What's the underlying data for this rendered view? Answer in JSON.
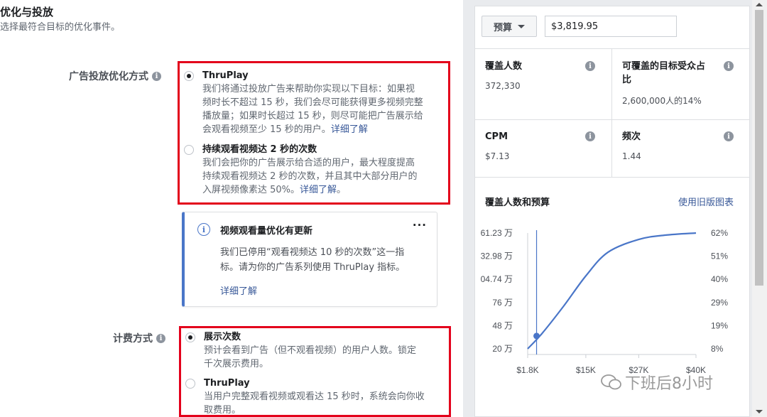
{
  "section": {
    "title": "优化与投放",
    "subtitle": "选择最符合目标的优化事件。"
  },
  "optimization": {
    "label": "广告投放优化方式",
    "options": [
      {
        "title": "ThruPlay",
        "desc_lines": [
          "我们将通过投放广告来帮助你实现以下目标：如果视",
          "频时长不超过 15 秒，我们会尽可能获得更多视频完整",
          "播放量；如果时长超过 15 秒，则尽可能把广告展示给"
        ],
        "desc_last": "会观看视频至少 15 秒的用户。",
        "link": "详细了解",
        "link_suffix": "",
        "selected": true
      },
      {
        "title": "持续观看视频达 2 秒的次数",
        "desc_lines": [
          "我们会把你的广告展示给合适的用户，最大程度提高",
          "持续观看视频达 2 秒的次数，并且其中大部分用户的"
        ],
        "desc_last": "入屏视频像素达 50%。",
        "link": "详细了解",
        "link_suffix": "。",
        "selected": false
      }
    ]
  },
  "notice": {
    "title": "视频观看量优化有更新",
    "more": "···",
    "body_lines": [
      "我们已停用“观看视频达 10 秒的次数”这一指",
      "标。请为你的广告系列使用 ThruPlay 指标。"
    ],
    "link": "详细了解"
  },
  "billing": {
    "label": "计费方式",
    "options": [
      {
        "title": "展示次数",
        "desc_lines": [
          "预计会看到广告（但不观看视频）的用户人数。锁定",
          "千次展示费用。"
        ],
        "selected": true
      },
      {
        "title": "ThruPlay",
        "desc_lines": [
          "当用户完整观看视频或观看达 15 秒时，系统会向你收",
          "取费用。"
        ],
        "selected": false
      }
    ]
  },
  "budget": {
    "select_label": "预算",
    "value": "$3,819.95"
  },
  "metrics": {
    "reach_label": "覆盖人数",
    "reach_value": "372,330",
    "audience_label_line1": "可覆盖的目标受众占",
    "audience_label_line2": "比",
    "audience_value": "2,600,000人的14%",
    "cpm_label": "CPM",
    "cpm_value": "$7.13",
    "frequency_label": "频次",
    "frequency_value": "1.44"
  },
  "chart": {
    "title": "覆盖人数和预算",
    "link": "使用旧版图表"
  },
  "chart_data": {
    "type": "line",
    "title": "覆盖人数和预算",
    "x_ticks": [
      "$1.8K",
      "$15K",
      "$27K",
      "$40K"
    ],
    "y_left_ticks": [
      "61.23 万",
      "32.98 万",
      "04.74 万",
      "76 万",
      "48 万",
      "20 万"
    ],
    "y_right_ticks": [
      "62%",
      "51%",
      "40%",
      "29%",
      "19%",
      "8%"
    ],
    "series": [
      {
        "x": [
          1.8,
          5,
          10,
          15,
          20,
          27,
          33,
          40
        ],
        "y_percent": [
          8,
          15,
          28,
          42,
          53,
          59,
          61,
          62
        ]
      }
    ],
    "marker": {
      "x": 3.82,
      "y_percent": 14
    },
    "line_color": "#4a76c8"
  },
  "watermark": {
    "text": "下班后8小时"
  },
  "colors": {
    "highlight_border": "#e3001b",
    "link": "#385898",
    "accent": "#4a76c8"
  }
}
